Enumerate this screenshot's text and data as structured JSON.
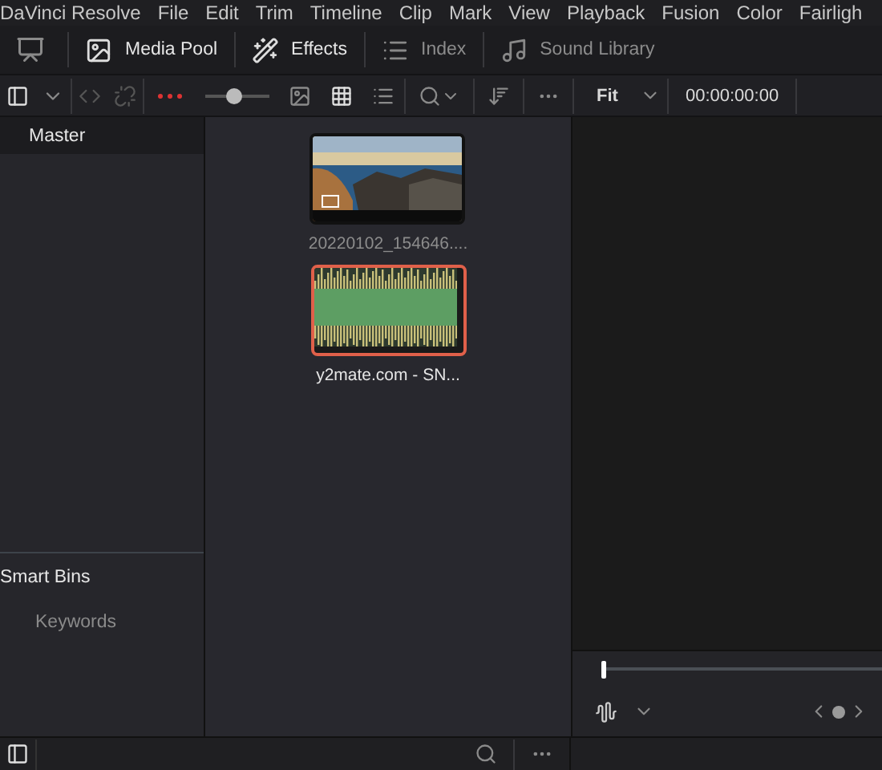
{
  "menu_bar": {
    "items": [
      "DaVinci Resolve",
      "File",
      "Edit",
      "Trim",
      "Timeline",
      "Clip",
      "Mark",
      "View",
      "Playback",
      "Fusion",
      "Color",
      "Fairligh"
    ]
  },
  "toolbar": {
    "items": [
      {
        "kind": "icon-only"
      },
      {
        "kind": "tool",
        "label": "Media Pool",
        "selected": true
      },
      {
        "kind": "tool",
        "label": "Effects",
        "selected": true
      },
      {
        "kind": "tool",
        "label": "Index",
        "selected": false
      },
      {
        "kind": "tool",
        "label": "Sound Library",
        "selected": false
      }
    ]
  },
  "pool_bar": {
    "zoom": {
      "level": 0.45
    },
    "view_modes": [
      {
        "selected": false
      },
      {
        "selected": true
      },
      {
        "selected": false
      }
    ]
  },
  "viewer_bar": {
    "fit": "Fit",
    "timecode": "00:00:00:00"
  },
  "bins": {
    "master": {
      "label": "Master",
      "selected": true
    },
    "smart_bins": {
      "title": "Smart Bins",
      "items": [
        "Keywords"
      ]
    }
  },
  "clips": [
    {
      "kind": "video",
      "name": "20220102_154646....",
      "selected": false
    },
    {
      "kind": "audio",
      "name": "y2mate.com - SN...",
      "selected": true
    }
  ],
  "scrubber": {
    "level": 0
  }
}
